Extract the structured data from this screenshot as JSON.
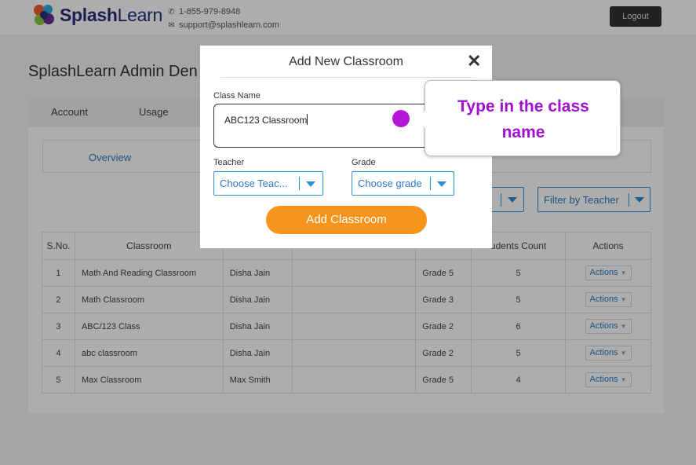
{
  "header": {
    "brand_splash": "Splash",
    "brand_learn": "Learn",
    "phone": "1-855-979-8948",
    "email": "support@splashlearn.com",
    "logout_label": "Logout"
  },
  "page": {
    "title": "SplashLearn Admin Den"
  },
  "tabs": {
    "account": "Account",
    "usage": "Usage"
  },
  "subtabs": {
    "overview": "Overview"
  },
  "filters": {
    "teacher": "Filter by Teacher"
  },
  "table": {
    "headers": [
      "S.No.",
      "Classroom",
      "",
      "",
      "",
      "udents Count",
      "Actions"
    ],
    "rows": [
      {
        "sno": "1",
        "classroom": "Math And Reading Classroom",
        "teacher": "Disha Jain",
        "grade": "Grade 5",
        "count": "5",
        "actions": "Actions"
      },
      {
        "sno": "2",
        "classroom": "Math Classroom",
        "teacher": "Disha Jain",
        "grade": "Grade 3",
        "count": "5",
        "actions": "Actions"
      },
      {
        "sno": "3",
        "classroom": "ABC/123 Class",
        "teacher": "Disha Jain",
        "grade": "Grade 2",
        "count": "6",
        "actions": "Actions"
      },
      {
        "sno": "4",
        "classroom": "abc classroom",
        "teacher": "Disha Jain",
        "grade": "Grade 2",
        "count": "5",
        "actions": "Actions"
      },
      {
        "sno": "5",
        "classroom": "Max Classroom",
        "teacher": "Max Smith",
        "grade": "Grade 5",
        "count": "4",
        "actions": "Actions"
      }
    ]
  },
  "modal": {
    "title": "Add New Classroom",
    "close_glyph": "✕",
    "class_name_label": "Class Name",
    "class_name_value": "ABC123 Classroom",
    "teacher_label": "Teacher",
    "teacher_placeholder": "Choose Teac...",
    "grade_label": "Grade",
    "grade_placeholder": "Choose grade",
    "submit_label": "Add Classroom"
  },
  "tooltip": {
    "line1": "Type in the class",
    "line2": "name"
  },
  "colors": {
    "accent_orange": "#f7941d",
    "link_blue": "#2b7bc4",
    "tooltip_purple": "#a10fd1",
    "dot_purple": "#b316d9"
  },
  "icons": [
    "splashlearn-logo-icon",
    "phone-icon",
    "mail-icon",
    "close-icon",
    "chevron-down-icon"
  ]
}
